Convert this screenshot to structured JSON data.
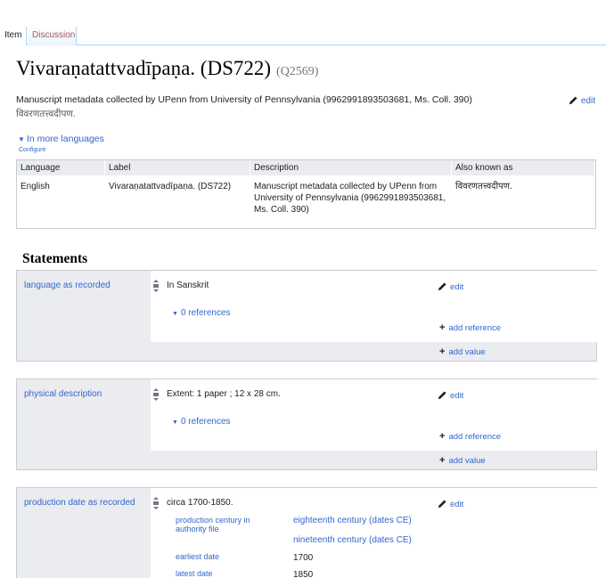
{
  "tabs": {
    "item": "Item",
    "discussion": "Discussion"
  },
  "heading": {
    "title": "Vivaraṇatattvadīpaṇa. (DS722)",
    "qid": "(Q2569)"
  },
  "description": "Manuscript metadata collected by UPenn from University of Pennsylvania (9962991893503681, Ms. Coll. 390)",
  "alias": "विवरणतत्त्वदीपण.",
  "edit_label": "edit",
  "languages": {
    "toggle": "In more languages",
    "configure": "Configure",
    "headers": [
      "Language",
      "Label",
      "Description",
      "Also known as"
    ],
    "rows": [
      {
        "language": "English",
        "label": "Vivaraṇatattvadīpaṇa. (DS722)",
        "description_l1": "Manuscript metadata collected by UPenn from",
        "description_l2": "University of Pennsylvania (9962991893503681,",
        "description_l3": "Ms. Coll. 390)",
        "aka": "विवरणतत्त्वदीपण."
      }
    ]
  },
  "statements_heading": "Statements",
  "statements": [
    {
      "property": "language as recorded",
      "value": "In Sanskrit",
      "references": "0 references",
      "add_reference": "add reference",
      "add_value": "add value"
    },
    {
      "property": "physical description",
      "value": "Extent: 1 paper ; 12 x 28 cm.",
      "references": "0 references",
      "add_reference": "add reference",
      "add_value": "add value"
    },
    {
      "property": "production date as recorded",
      "value": "circa 1700-1850.",
      "qualifiers": [
        {
          "property_l1": "production century in",
          "property_l2": "authority file",
          "values": [
            "eighteenth century (dates CE)",
            "nineteenth century (dates CE)"
          ]
        },
        {
          "property_l1": "earliest date",
          "values": [
            "1700"
          ]
        },
        {
          "property_l1": "latest date",
          "values": [
            "1850"
          ]
        }
      ]
    }
  ]
}
